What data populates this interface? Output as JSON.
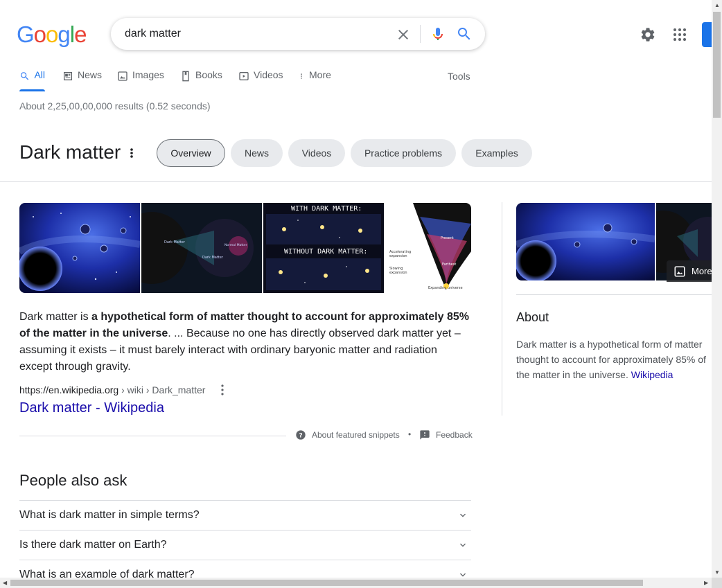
{
  "header": {
    "logo_letters": [
      "G",
      "o",
      "o",
      "g",
      "l",
      "e"
    ],
    "logo_colors": [
      "#4285F4",
      "#EA4335",
      "#FBBC05",
      "#4285F4",
      "#34A853",
      "#EA4335"
    ],
    "search_value": "dark matter",
    "icons": [
      "close-icon",
      "mic-icon",
      "search-icon",
      "gear-icon",
      "apps-icon"
    ]
  },
  "tabs": [
    {
      "label": "All",
      "icon": "search-icon",
      "active": true
    },
    {
      "label": "News",
      "icon": "news-icon"
    },
    {
      "label": "Images",
      "icon": "image-icon"
    },
    {
      "label": "Books",
      "icon": "book-icon"
    },
    {
      "label": "Videos",
      "icon": "video-icon"
    },
    {
      "label": "More",
      "icon": "more-vert-icon"
    }
  ],
  "tools_label": "Tools",
  "result_stats": "About 2,25,00,00,000 results (0.52 seconds)",
  "topic": {
    "title": "Dark matter",
    "chips": [
      "Overview",
      "News",
      "Videos",
      "Practice problems",
      "Examples"
    ],
    "selected_chip": "Overview"
  },
  "featured_images": [
    {
      "alt": "Galaxy cluster with black holes"
    },
    {
      "alt": "Pie chart showing Dark Energy, Dark Matter, Normal Matter",
      "labels": [
        "Dark Matter (~27%)",
        "Normal Matter (~5%)"
      ]
    },
    {
      "alt": "With and without dark matter comparison",
      "labels": [
        "WITH DARK MATTER:",
        "WITHOUT DARK MATTER:"
      ]
    },
    {
      "alt": "Expanding universe diagram",
      "labels": [
        "Present",
        "Accelerating expansion",
        "Slowing expansion",
        "Farthest supernova",
        "Expanding universe"
      ]
    }
  ],
  "snippet": {
    "prefix": "Dark matter is ",
    "bold": "a hypothetical form of matter thought to account for approximately 85% of the matter in the universe",
    "suffix": ". ... Because no one has directly observed dark matter yet – assuming it exists – it must barely interact with ordinary baryonic matter and radiation except through gravity.",
    "cite_domain": "https://en.wikipedia.org",
    "cite_path": " › wiki › Dark_matter",
    "link_title": "Dark matter - Wikipedia",
    "about_label": "About featured snippets",
    "dot": "•",
    "feedback_label": "Feedback"
  },
  "paa": {
    "title": "People also ask",
    "questions": [
      "What is dark matter in simple terms?",
      "Is there dark matter on Earth?",
      "What is an example of dark matter?"
    ]
  },
  "knowledge_panel": {
    "more_label": "More",
    "about_title": "About",
    "description": "Dark matter is a hypothetical form of matter thought to account for approximately 85% of the matter in the universe. ",
    "source_link": "Wikipedia"
  }
}
